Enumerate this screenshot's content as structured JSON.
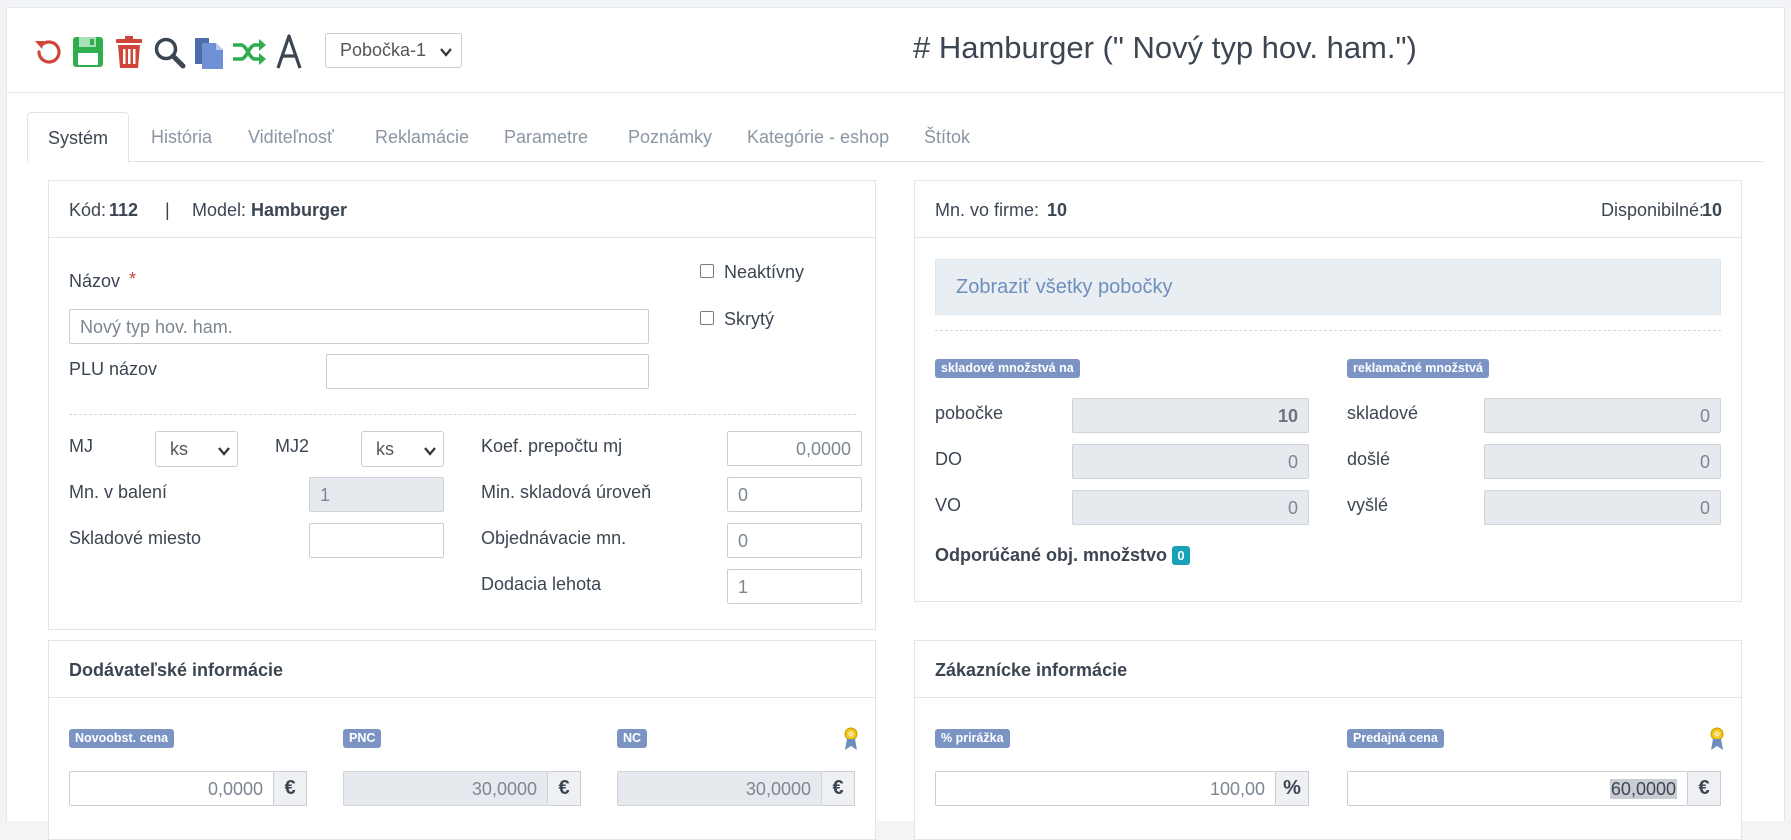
{
  "toolbar": {
    "icons": [
      "undo-icon",
      "save-icon",
      "trash-icon",
      "search-icon",
      "copy-icon",
      "shuffle-icon",
      "font-icon"
    ],
    "branch_select": "Pobočka-1"
  },
  "page_title": "# Hamburger (\" Nový typ hov. ham.\")",
  "tabs": [
    "Systém",
    "História",
    "Viditeľnosť",
    "Reklamácie",
    "Parametre",
    "Poznámky",
    "Kategórie - eshop",
    "Štítok"
  ],
  "system_card": {
    "code_label": "Kód:",
    "code_value": "112",
    "separator": "|",
    "model_label": "Model:",
    "model_value": "Hamburger",
    "name_label": "Názov",
    "required_mark": "*",
    "name_placeholder": "Nový typ hov. ham.",
    "plu_label": "PLU názov",
    "plu_value": "",
    "inactive_label": "Neaktívny",
    "hidden_label": "Skrytý",
    "mj_label": "MJ",
    "mj_value": "ks",
    "mj2_label": "MJ2",
    "mj2_value": "ks",
    "koef_label": "Koef. prepočtu mj",
    "koef_value": "0,0000",
    "pack_label": "Mn. v balení",
    "pack_value": "1",
    "min_stock_label": "Min. skladová úroveň",
    "min_stock_value": "0",
    "location_label": "Skladové miesto",
    "location_value": "",
    "order_qty_label": "Objednávacie mn.",
    "order_qty_value": "0",
    "lead_time_label": "Dodacia lehota",
    "lead_time_value": "1"
  },
  "stock_card": {
    "company_qty_label": "Mn. vo firme:",
    "company_qty_value": "10",
    "available_label": "Disponibilné:",
    "available_value": "10",
    "show_all_label": "Zobraziť všetky pobočky",
    "stock_badge": "skladové množstvá na",
    "claim_badge": "reklamačné množstvá",
    "rows_left": [
      {
        "label": "pobočke",
        "value": "10"
      },
      {
        "label": "DO",
        "value": "0"
      },
      {
        "label": "VO",
        "value": "0"
      }
    ],
    "rows_right": [
      {
        "label": "skladové",
        "value": "0"
      },
      {
        "label": "došlé",
        "value": "0"
      },
      {
        "label": "vyšlé",
        "value": "0"
      }
    ],
    "recommended_label": "Odporúčané obj. množstvo",
    "recommended_value": "0"
  },
  "supplier_card": {
    "title": "Dodávateľské informácie",
    "new_price_badge": "Novoobst. cena",
    "new_price_value": "0,0000",
    "pnc_badge": "PNC",
    "pnc_value": "30,0000",
    "nc_badge": "NC",
    "nc_value": "30,0000",
    "currency": "€"
  },
  "customer_card": {
    "title": "Zákaznícke informácie",
    "markup_badge": "% prirážka",
    "markup_value": "100,00",
    "percent_symbol": "%",
    "sale_price_badge": "Predajná cena",
    "sale_price_value": "60,0000",
    "currency": "€"
  },
  "colors": {
    "badge": "#7c94c4",
    "teal": "#17a2b8",
    "save_green": "#2eae4f",
    "delete_red": "#d0453a",
    "copy_blue": "#5b7ec7"
  }
}
